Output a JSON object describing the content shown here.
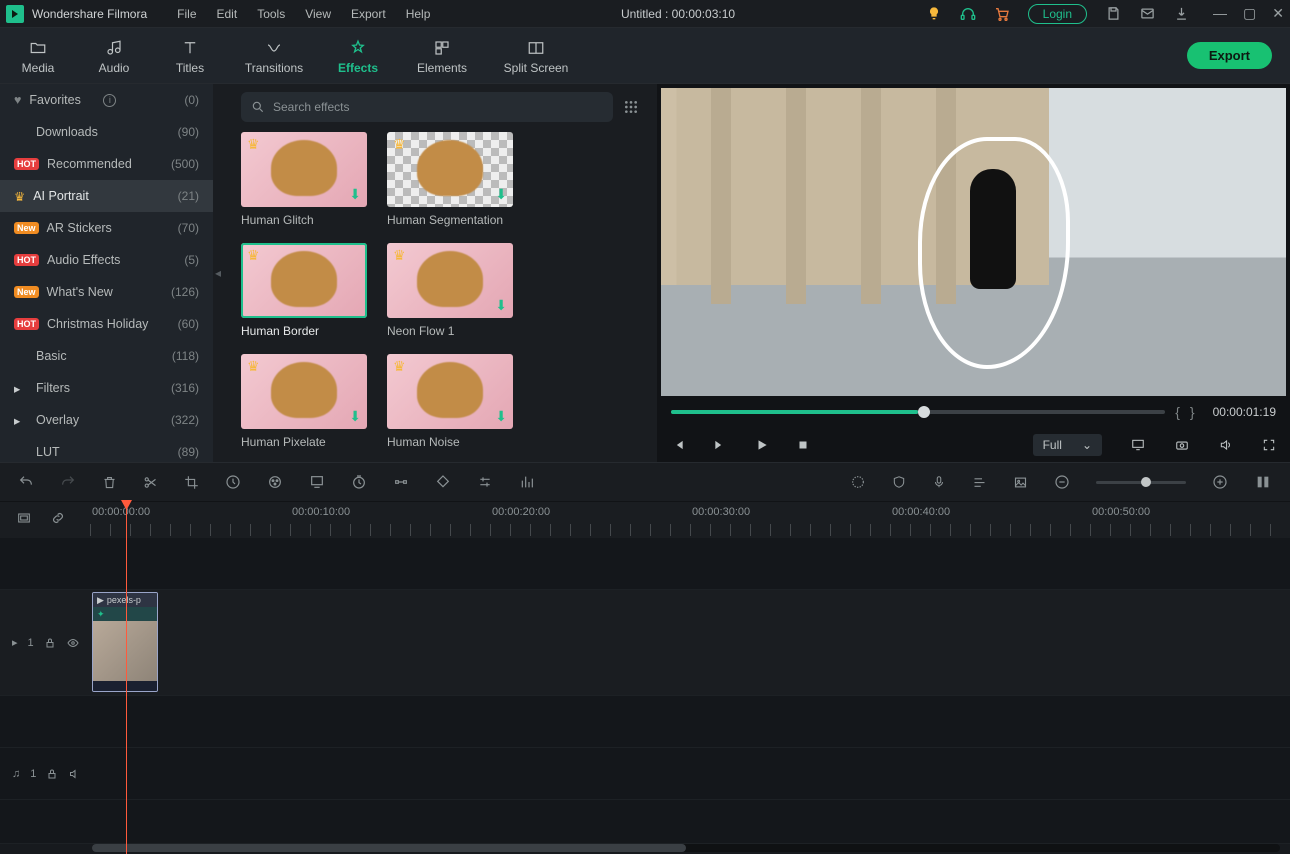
{
  "app_title": "Wondershare Filmora",
  "menu": [
    "File",
    "Edit",
    "Tools",
    "View",
    "Export",
    "Help"
  ],
  "project_title": "Untitled : 00:00:03:10",
  "login_label": "Login",
  "tabs": [
    {
      "label": "Media"
    },
    {
      "label": "Audio"
    },
    {
      "label": "Titles"
    },
    {
      "label": "Transitions"
    },
    {
      "label": "Effects"
    },
    {
      "label": "Elements"
    },
    {
      "label": "Split Screen"
    }
  ],
  "export_label": "Export",
  "sidebar": [
    {
      "label": "Favorites",
      "count": "(0)",
      "pre": "heart",
      "info": true
    },
    {
      "label": "Downloads",
      "count": "(90)"
    },
    {
      "label": "Recommended",
      "count": "(500)",
      "badge": "HOT"
    },
    {
      "label": "AI Portrait",
      "count": "(21)",
      "pre": "crown",
      "active": true
    },
    {
      "label": "AR Stickers",
      "count": "(70)",
      "badge": "New"
    },
    {
      "label": "Audio Effects",
      "count": "(5)",
      "badge": "HOT"
    },
    {
      "label": "What's New",
      "count": "(126)",
      "badge": "New"
    },
    {
      "label": "Christmas Holiday",
      "count": "(60)",
      "badge": "HOT"
    },
    {
      "label": "Basic",
      "count": "(118)"
    },
    {
      "label": "Filters",
      "count": "(316)",
      "pre": "chev"
    },
    {
      "label": "Overlay",
      "count": "(322)",
      "pre": "chev"
    },
    {
      "label": "LUT",
      "count": "(89)"
    }
  ],
  "search": {
    "placeholder": "Search effects"
  },
  "effects": [
    {
      "label": "Human Glitch"
    },
    {
      "label": "Human Segmentation",
      "checker": true
    },
    {
      "label": "Human Border",
      "sel": true
    },
    {
      "label": "Neon Flow 1"
    },
    {
      "label": "Human Pixelate"
    },
    {
      "label": "Human Noise"
    }
  ],
  "brace_l": "{",
  "brace_r": "}",
  "preview": {
    "timecode": "00:00:01:19",
    "quality": "Full"
  },
  "ruler": [
    "00:00:00:00",
    "00:00:10:00",
    "00:00:20:00",
    "00:00:30:00",
    "00:00:40:00",
    "00:00:50:00"
  ],
  "clip": {
    "label": "pexels-p"
  },
  "track_video": "1",
  "track_audio": "1"
}
